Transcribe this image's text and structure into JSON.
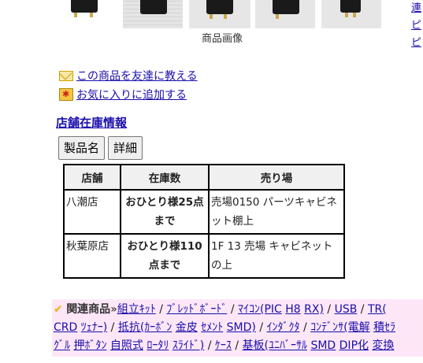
{
  "gallery": {
    "caption": "商品画像"
  },
  "side_links": [
    "連",
    "ピ",
    "ピ"
  ],
  "actions": {
    "tell_friend": "この商品を友達に教える",
    "add_favorite": "お気に入りに追加する"
  },
  "stock": {
    "heading": "店舗在庫情報",
    "buttons": [
      "製品名",
      "詳細"
    ],
    "columns": [
      "店舗",
      "在庫数",
      "売り場"
    ],
    "rows": [
      {
        "store": "八潮店",
        "qty": "おひとり様25点まで",
        "location": "売場0150 パーツキャビネット棚上"
      },
      {
        "store": "秋葉原店",
        "qty": "おひとり様110点まで",
        "location": "1F 13 売場 キャビネットの上"
      }
    ]
  },
  "related": {
    "label": "関連商品",
    "line1": [
      "組立ｷｯﾄ",
      "ﾌﾞﾚｯﾄﾞﾎﾞｰﾄﾞ",
      "ﾏｲｺﾝ(PIC",
      "H8",
      "RX)",
      "USB",
      "TR("
    ],
    "line2": [
      "CRD",
      "ﾂｪﾅｰ)",
      "抵抗(ｶｰﾎﾞﾝ",
      "金皮",
      "ｾﾒﾝﾄ",
      "SMD)",
      "ｲﾝﾀﾞｸﾀ",
      "ｺﾝﾃﾞﾝｻ(電解",
      "積ｾﾗ"
    ],
    "line3": [
      "ｸﾞﾙ",
      "押ﾎﾞﾀﾝ",
      "自照式",
      "ﾛｰﾀﾘ",
      "ｽﾗｲﾄﾞ)",
      "ｹｰｽ",
      "基板(ﾕﾆﾊﾞｰｻﾙ",
      "SMD",
      "DIP化",
      "変換"
    ]
  }
}
